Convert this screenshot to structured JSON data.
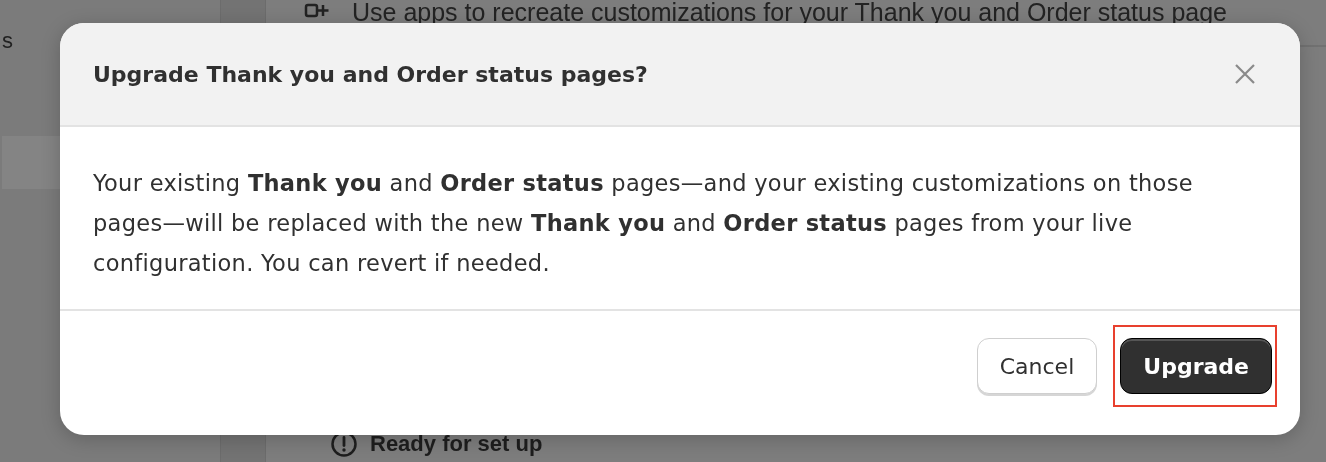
{
  "background": {
    "sidebar": {
      "items": [
        {
          "label": "s",
          "selected": false
        },
        {
          "selected": true
        }
      ]
    },
    "banner": {
      "text": "Use apps to recreate customizations for your Thank you and Order status page"
    },
    "status": {
      "text": "Ready for set up"
    }
  },
  "dialog": {
    "title": "Upgrade Thank you and Order status pages?",
    "body": "Your existing **Thank you** and **Order status** pages—and your existing customizations on those pages—will be replaced with the new **Thank you** and **Order status** pages from your live configuration. You can revert if needed.",
    "buttons": [
      {
        "label": "Cancel",
        "kind": "secondary",
        "highlighted": false
      },
      {
        "label": "Upgrade",
        "kind": "primary",
        "highlighted": true
      }
    ]
  }
}
